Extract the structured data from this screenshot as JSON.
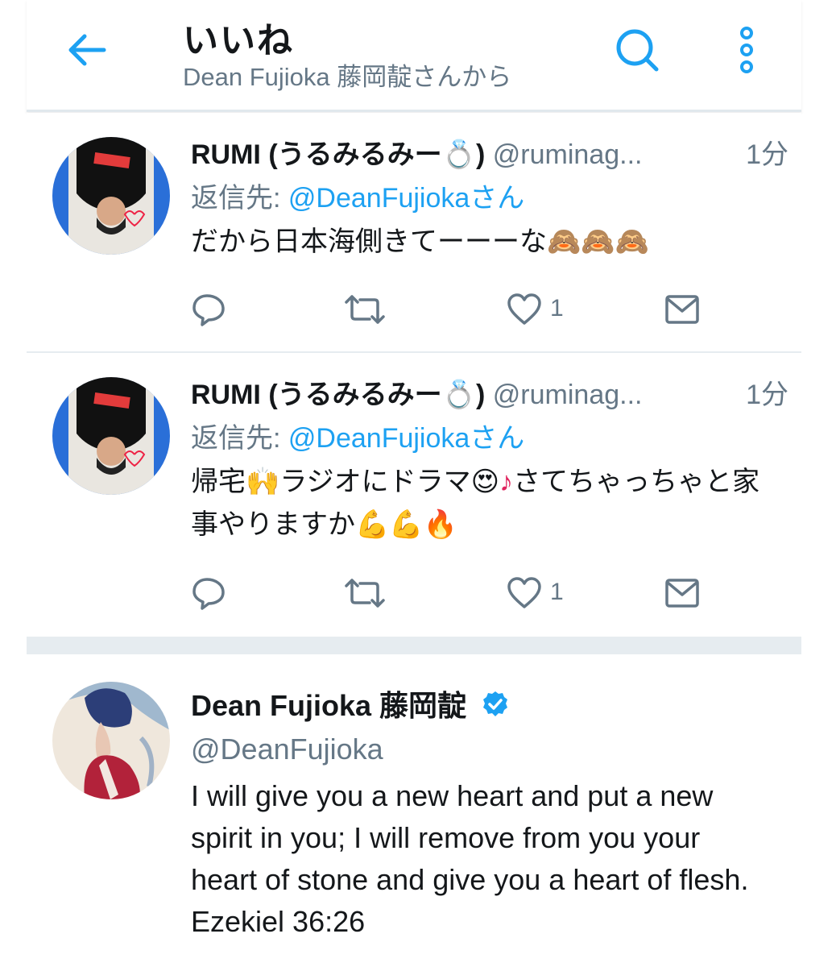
{
  "header": {
    "title": "いいね",
    "subtitle": "Dean Fujioka 藤岡靛さんから",
    "back_icon": "arrow-left-icon",
    "search_icon": "search-icon",
    "more_icon": "more-vertical-icon"
  },
  "colors": {
    "accent": "#1da1f2",
    "secondary_text": "#657786",
    "primary_text": "#14171a",
    "divider": "#e6ecf0"
  },
  "tweets": [
    {
      "name": "RUMI (うるみるみー",
      "name_emoji": "💍",
      "name_close": ")",
      "handle": "@ruminag...",
      "time": "1分",
      "reply_label": "返信先: ",
      "reply_mention": "@DeanFujiokaさん",
      "text_parts": [
        "だから日本海側きてーーーな",
        "🙈🙈🙈"
      ],
      "likes": "1"
    },
    {
      "name": "RUMI (うるみるみー",
      "name_emoji": "💍",
      "name_close": ")",
      "handle": "@ruminag...",
      "time": "1分",
      "reply_label": "返信先: ",
      "reply_mention": "@DeanFujiokaさん",
      "text_parts": [
        "帰宅",
        "🙌",
        "ラジオにドラマ",
        "😍",
        "♪",
        "さてちゃっちゃと家事やりますか",
        "💪💪🔥"
      ],
      "likes": "1"
    },
    {
      "name": "Dean Fujioka 藤岡靛",
      "handle": "@DeanFujioka",
      "text": "I will give you a new heart and put a new spirit in you; I will remove from you your heart of stone and give you a heart of flesh. Ezekiel 36:26"
    }
  ]
}
